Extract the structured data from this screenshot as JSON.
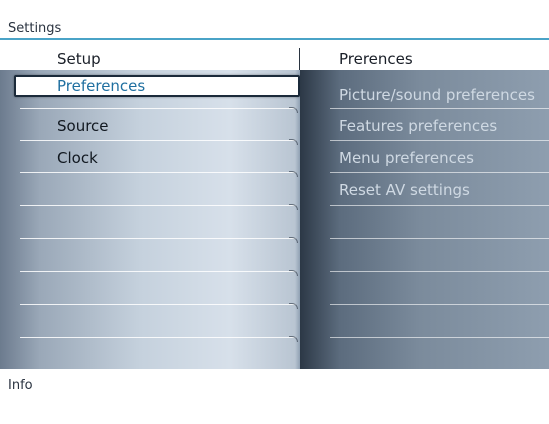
{
  "header": {
    "title": "Settings"
  },
  "left_column": {
    "header": "Setup",
    "items": [
      {
        "label": "Preferences",
        "selected": true
      },
      {
        "label": "Source",
        "selected": false
      },
      {
        "label": "Clock",
        "selected": false
      }
    ]
  },
  "right_column": {
    "header": "Prerences",
    "items": [
      {
        "label": "Picture/sound preferences"
      },
      {
        "label": "Features preferences"
      },
      {
        "label": "Menu preferences"
      },
      {
        "label": "Reset AV settings"
      }
    ]
  },
  "footer": {
    "info_label": "Info"
  },
  "colors": {
    "accent": "#4aa3c7",
    "selected_text": "#1f6fa0"
  }
}
